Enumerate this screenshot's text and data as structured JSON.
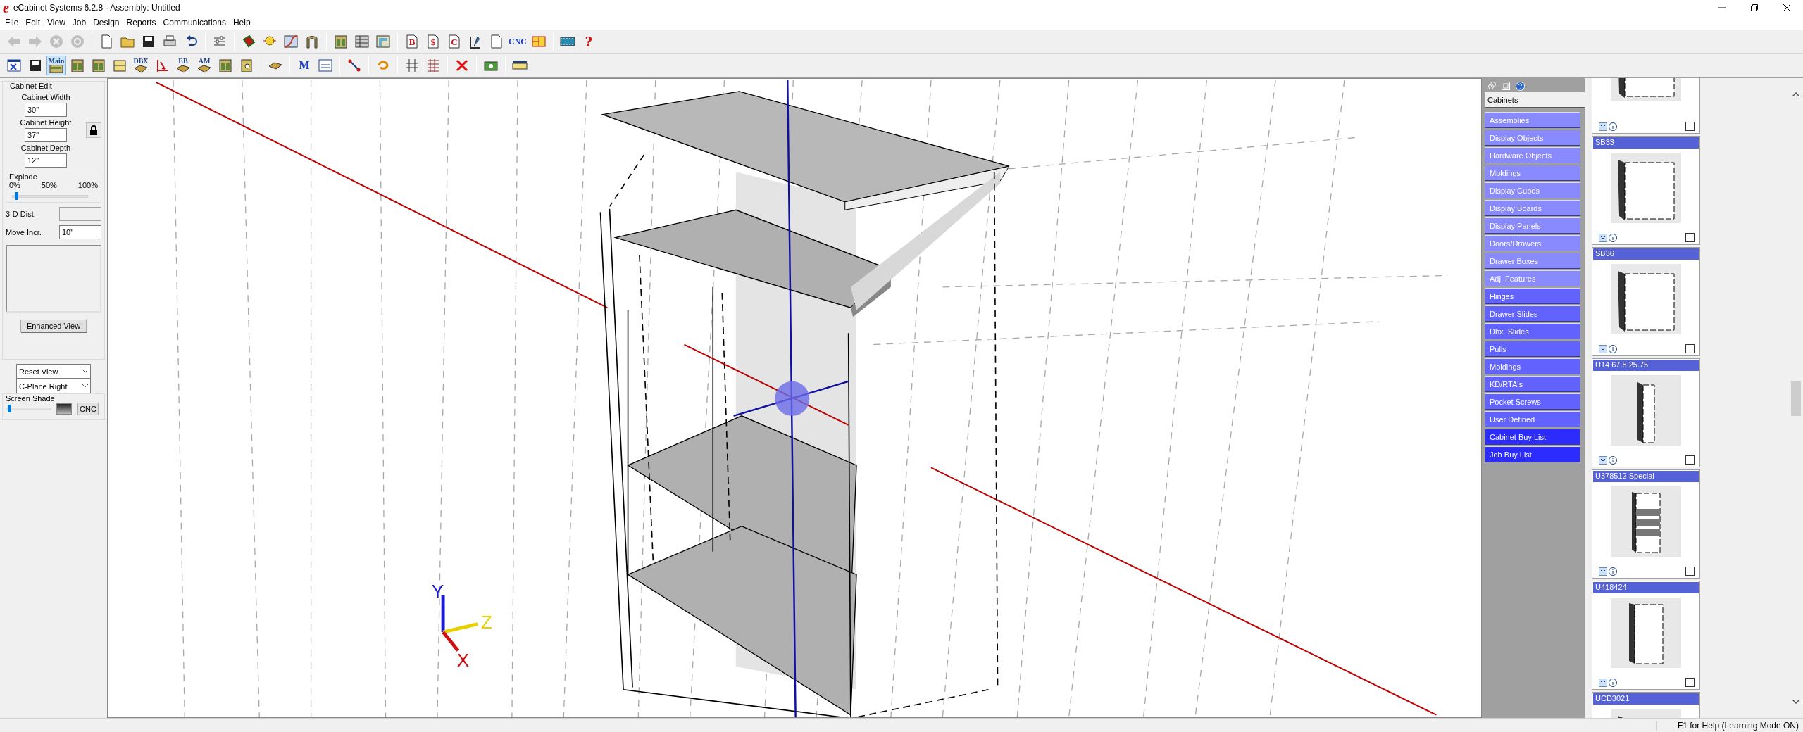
{
  "window": {
    "logo": "e",
    "title": "eCabinet Systems 6.2.8 - Assembly: Untitled"
  },
  "menu": [
    "File",
    "Edit",
    "View",
    "Job",
    "Design",
    "Reports",
    "Communications",
    "Help"
  ],
  "toolbar_1": [
    {
      "kind": "arrow-left",
      "disabled": true
    },
    {
      "kind": "arrow-right",
      "disabled": true
    },
    {
      "kind": "circle-x",
      "disabled": true
    },
    {
      "kind": "circle-refresh",
      "disabled": true
    },
    {
      "kind": "sep"
    },
    {
      "kind": "page",
      "disabled": false
    },
    {
      "kind": "folder",
      "disabled": false
    },
    {
      "kind": "disk",
      "disabled": false
    },
    {
      "kind": "printer",
      "disabled": false
    },
    {
      "kind": "undo",
      "disabled": false
    },
    {
      "kind": "sep"
    },
    {
      "kind": "sliders",
      "disabled": false
    },
    {
      "kind": "sep"
    },
    {
      "kind": "bucket",
      "disabled": false
    },
    {
      "kind": "bulb",
      "disabled": false
    },
    {
      "kind": "gradient",
      "disabled": false
    },
    {
      "kind": "frame",
      "disabled": false
    },
    {
      "kind": "sep"
    },
    {
      "kind": "cabinet",
      "disabled": false
    },
    {
      "kind": "panels",
      "disabled": false
    },
    {
      "kind": "corner",
      "disabled": false
    },
    {
      "kind": "sep"
    },
    {
      "kind": "doc",
      "label": "B",
      "disabled": false
    },
    {
      "kind": "doc",
      "label": "$",
      "disabled": false
    },
    {
      "kind": "doc",
      "label": "C",
      "disabled": false
    },
    {
      "kind": "measure",
      "disabled": false
    },
    {
      "kind": "edit-doc",
      "disabled": false
    },
    {
      "kind": "text",
      "label": "CNC",
      "disabled": false
    },
    {
      "kind": "layout",
      "disabled": false
    },
    {
      "kind": "sep"
    },
    {
      "kind": "film",
      "disabled": false
    },
    {
      "kind": "help",
      "label": "?",
      "disabled": false
    }
  ],
  "toolbar_2": [
    {
      "kind": "window",
      "selected": false
    },
    {
      "kind": "disk",
      "selected": false
    },
    {
      "kind": "text-cabinet",
      "label": "Main",
      "selected": true
    },
    {
      "kind": "cabinet",
      "selected": false
    },
    {
      "kind": "cabinet",
      "selected": false
    },
    {
      "kind": "drawer",
      "selected": false
    },
    {
      "kind": "text-box",
      "label": "DBX",
      "selected": false
    },
    {
      "kind": "dimension",
      "selected": false
    },
    {
      "kind": "text-box",
      "label": "EB",
      "selected": false
    },
    {
      "kind": "text-box",
      "label": "AM",
      "selected": false
    },
    {
      "kind": "cabinet",
      "selected": false
    },
    {
      "kind": "hinge",
      "selected": false
    },
    {
      "kind": "sep"
    },
    {
      "kind": "tray",
      "selected": false
    },
    {
      "kind": "sep"
    },
    {
      "kind": "logo",
      "label": "M",
      "selected": false
    },
    {
      "kind": "calculator",
      "selected": false
    },
    {
      "kind": "sep"
    },
    {
      "kind": "pointer",
      "selected": false
    },
    {
      "kind": "sep"
    },
    {
      "kind": "rotate",
      "selected": false
    },
    {
      "kind": "sep"
    },
    {
      "kind": "divider",
      "selected": false
    },
    {
      "kind": "grid",
      "selected": false
    },
    {
      "kind": "sep"
    },
    {
      "kind": "cross",
      "selected": false
    },
    {
      "kind": "sep"
    },
    {
      "kind": "camera",
      "selected": false
    },
    {
      "kind": "sep"
    },
    {
      "kind": "ruler",
      "selected": false
    }
  ],
  "cabinet_edit": {
    "title": "Cabinet Edit",
    "fields": [
      {
        "label": "Cabinet Width",
        "value": "30\""
      },
      {
        "label": "Cabinet Height",
        "value": "37\""
      },
      {
        "label": "Cabinet Depth",
        "value": "12\""
      }
    ],
    "explode": {
      "title": "Explode",
      "ticks": [
        "0%",
        "50%",
        "100%"
      ],
      "level": 0.03
    },
    "distance_3d": {
      "label": "3-D Dist."
    },
    "move_increment": {
      "label": "Move Incr.",
      "value": "10\""
    },
    "enhanced_view_button": "Enhanced View"
  },
  "view_select": "Reset View",
  "plane_select": "C-Plane Right",
  "screen_shade": {
    "label": "Screen Shade",
    "level": 0.03,
    "button": "CNC"
  },
  "axis_labels": [
    "Y",
    "Z",
    "X"
  ],
  "catalog": {
    "tab": "Cabinets",
    "categories": [
      {
        "label": "Assemblies",
        "color": "#8a8aff"
      },
      {
        "label": "Display Objects",
        "color": "#8a8aff"
      },
      {
        "label": "Hardware Objects",
        "color": "#8a8aff"
      },
      {
        "label": "Moldings",
        "color": "#8a8aff"
      },
      {
        "label": "Display Cubes",
        "color": "#8a8aff"
      },
      {
        "label": "Display Boards",
        "color": "#8a8aff"
      },
      {
        "label": "Display Panels",
        "color": "#8a8aff"
      },
      {
        "label": "Doors/Drawers",
        "color": "#8a8aff"
      },
      {
        "label": "Drawer Boxes",
        "color": "#8a8aff"
      },
      {
        "label": "Adj. Features",
        "color": "#8a8aff"
      },
      {
        "label": "Hinges",
        "color": "#6262ff"
      },
      {
        "label": "Drawer Slides",
        "color": "#6262ff"
      },
      {
        "label": "Dbx. Slides",
        "color": "#6262ff"
      },
      {
        "label": "Pulls",
        "color": "#6262ff"
      },
      {
        "label": "Moldings",
        "color": "#6262ff"
      },
      {
        "label": "KD/RTA's",
        "color": "#6262ff"
      },
      {
        "label": "Pocket Screws",
        "color": "#6262ff"
      },
      {
        "label": "User Defined",
        "color": "#6262ff"
      },
      {
        "label": "Cabinet Buy List",
        "color": "#2c2cff"
      },
      {
        "label": "Job Buy List",
        "color": "#2c2cff"
      }
    ]
  },
  "thumbnails": [
    {
      "kind": "base",
      "checked": false
    },
    {
      "title": "SB33",
      "kind": "base",
      "checked": false
    },
    {
      "title": "SB36",
      "kind": "base",
      "checked": false
    },
    {
      "title": "U14 67.5 25.75",
      "kind": "tall-narrow",
      "checked": false
    },
    {
      "title": "U378512 Special",
      "kind": "tall-shelves",
      "checked": false
    },
    {
      "title": "U418424",
      "kind": "tall",
      "checked": false
    },
    {
      "title": "UCD3021",
      "kind": "base"
    }
  ],
  "status_bar": "F1 for Help (Learning Mode ON)"
}
